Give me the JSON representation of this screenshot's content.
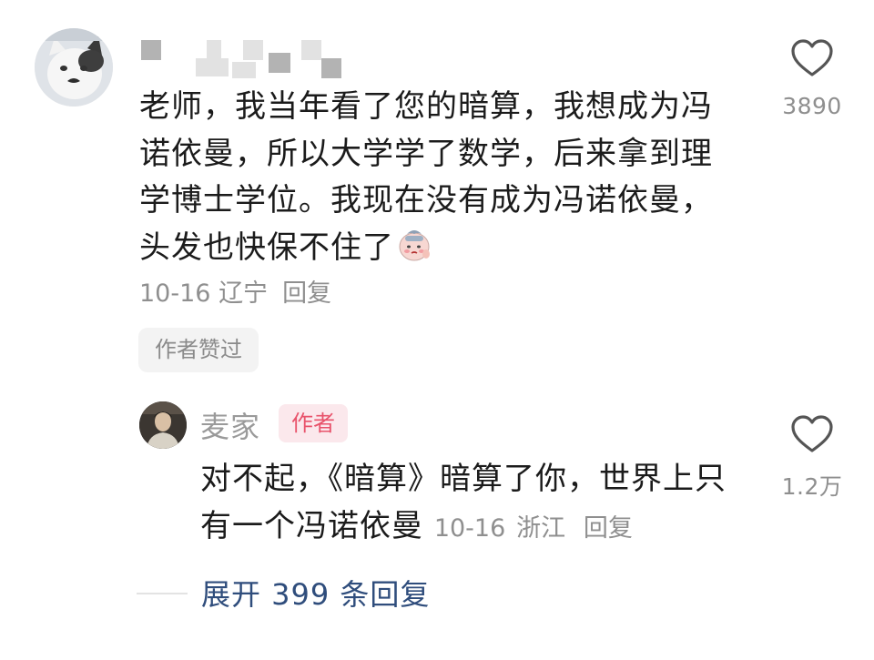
{
  "comment": {
    "text": "老师，我当年看了您的暗算，我想成为冯诺依曼，所以大学学了数学，后来拿到理学博士学位。我现在没有成为冯诺依曼，头发也快保不住了",
    "date": "10-16",
    "location": "辽宁",
    "reply_label": "回复",
    "author_liked_label": "作者赞过",
    "like_count": "3890",
    "emoji": "sweating-face-emoji"
  },
  "reply": {
    "username": "麦家",
    "badge": "作者",
    "text": "对不起，《暗算》暗算了你，世界上只有一个冯诺依曼",
    "date": "10-16",
    "location": "浙江",
    "reply_label": "回复",
    "like_count": "1.2万"
  },
  "expand": {
    "label": "展开 399 条回复"
  },
  "colors": {
    "text": "#1b1b1b",
    "meta": "#8f8f8f",
    "badge_bg": "#fbe8ec",
    "badge_text": "#e8536b",
    "expand_link": "#2f4d7c"
  }
}
